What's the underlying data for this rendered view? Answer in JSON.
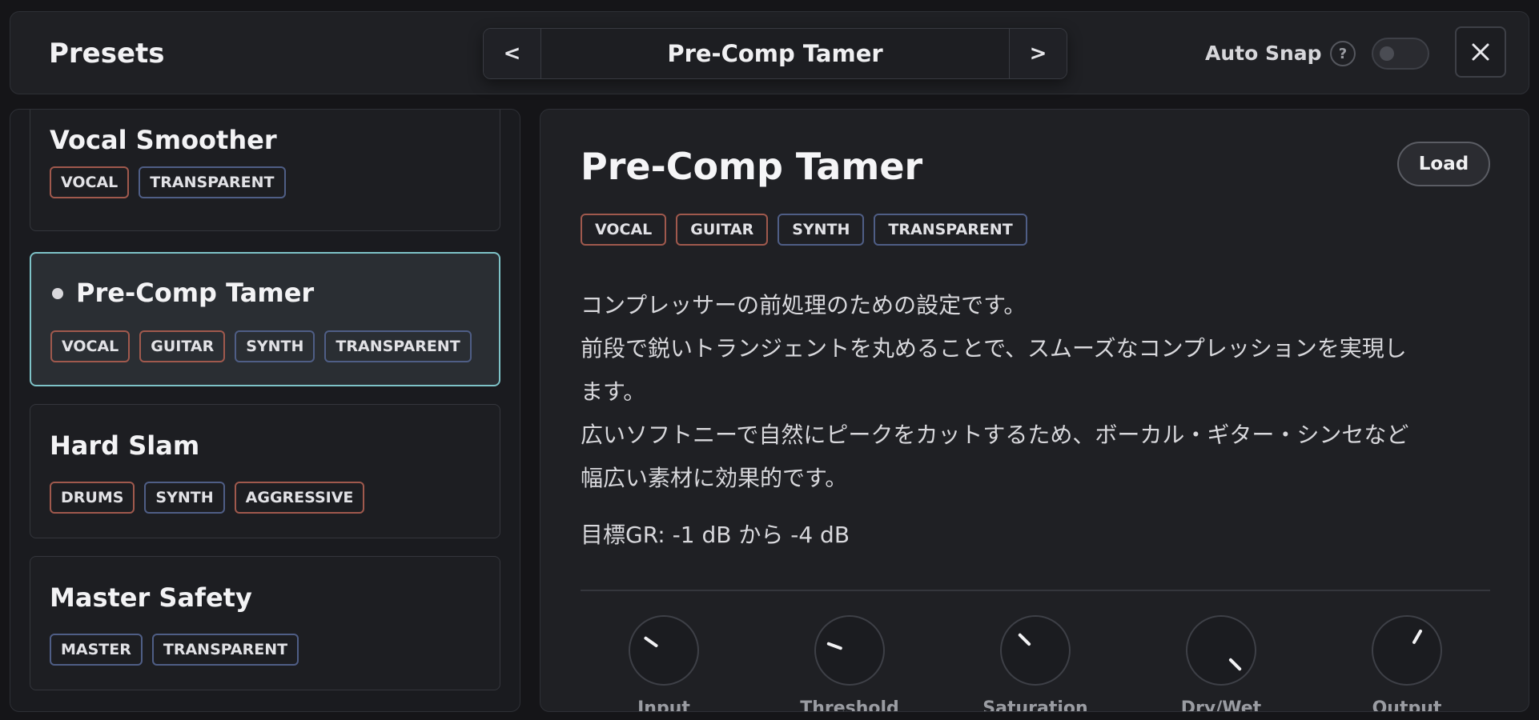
{
  "header": {
    "title": "Presets",
    "prev_label": "<",
    "next_label": ">",
    "current_preset": "Pre-Comp Tamer",
    "auto_snap_label": "Auto Snap",
    "help_label": "?",
    "auto_snap_enabled": false
  },
  "presets": [
    {
      "name": "Vocal Smoother",
      "tags": [
        "VOCAL",
        "TRANSPARENT"
      ],
      "active": false
    },
    {
      "name": "Pre-Comp Tamer",
      "tags": [
        "VOCAL",
        "GUITAR",
        "SYNTH",
        "TRANSPARENT"
      ],
      "active": true
    },
    {
      "name": "Hard Slam",
      "tags": [
        "DRUMS",
        "SYNTH",
        "AGGRESSIVE"
      ],
      "active": false
    },
    {
      "name": "Master Safety",
      "tags": [
        "MASTER",
        "TRANSPARENT"
      ],
      "active": false
    }
  ],
  "detail": {
    "title": "Pre-Comp Tamer",
    "load_label": "Load",
    "tags": [
      "VOCAL",
      "GUITAR",
      "SYNTH",
      "TRANSPARENT"
    ],
    "description": [
      "コンプレッサーの前処理のための設定です。",
      "前段で鋭いトランジェントを丸めることで、スムーズなコンプレッションを実現し",
      "ます。",
      "広いソフトニーで自然にピークをカットするため、ボーカル・ギター・シンセなど",
      "幅広い素材に効果的です。"
    ],
    "target_gr": "目標GR: -1 dB から -4 dB",
    "knobs": [
      "Input",
      "Threshold",
      "Saturation",
      "Dry/Wet",
      "Output"
    ]
  },
  "colors": {
    "accent_active_border": "#7ec3c8",
    "tag_warm_border": "#a0594d",
    "tag_cool_border": "#4f5e86"
  }
}
